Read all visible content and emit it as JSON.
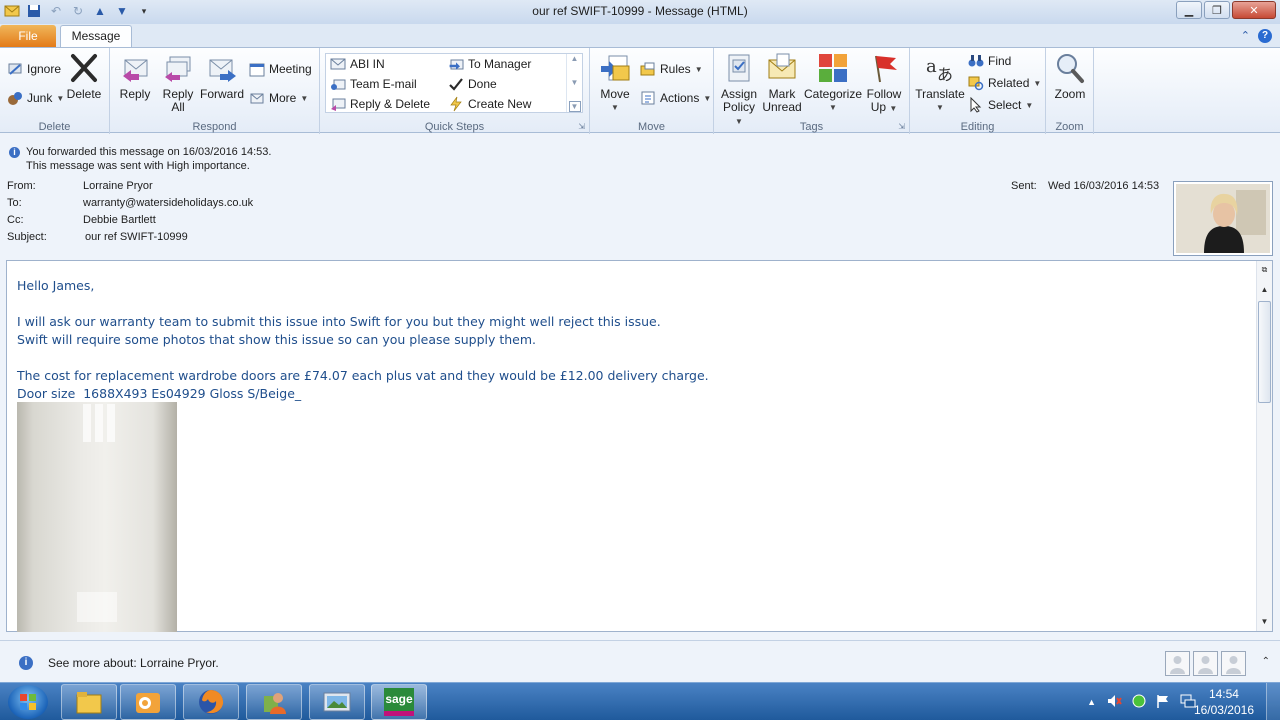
{
  "window": {
    "title": "our ref SWIFT-10999  -  Message (HTML)"
  },
  "tabs": {
    "file": "File",
    "message": "Message"
  },
  "ribbon": {
    "delete": {
      "label": "Delete",
      "ignore": "Ignore",
      "junk": "Junk",
      "delete": "Delete"
    },
    "respond": {
      "label": "Respond",
      "reply": "Reply",
      "reply_all_1": "Reply",
      "reply_all_2": "All",
      "forward": "Forward",
      "meeting": "Meeting",
      "more": "More"
    },
    "quick_steps": {
      "label": "Quick Steps",
      "items": [
        "ABI IN",
        "Team E-mail",
        "Reply & Delete",
        "To Manager",
        "Done",
        "Create New"
      ]
    },
    "move": {
      "label": "Move",
      "move": "Move",
      "rules": "Rules",
      "actions": "Actions"
    },
    "tags": {
      "label": "Tags",
      "assign_1": "Assign",
      "assign_2": "Policy",
      "mark_1": "Mark",
      "mark_2": "Unread",
      "categorize": "Categorize",
      "follow_1": "Follow",
      "follow_2": "Up"
    },
    "editing": {
      "label": "Editing",
      "translate": "Translate",
      "find": "Find",
      "related": "Related",
      "select": "Select"
    },
    "zoom": {
      "label": "Zoom",
      "zoom": "Zoom"
    }
  },
  "info": {
    "line1": "You forwarded this message on 16/03/2016 14:53.",
    "line2": "This message was sent with High importance."
  },
  "header": {
    "from_label": "From:",
    "from": "Lorraine Pryor",
    "to_label": "To:",
    "to": "warranty@watersideholidays.co.uk",
    "cc_label": "Cc:",
    "cc": "Debbie Bartlett",
    "subject_label": "Subject:",
    "subject": "our ref SWIFT-10999",
    "sent_label": "Sent:",
    "sent": "Wed 16/03/2016 14:53"
  },
  "body": {
    "lines": [
      "Hello James,",
      "",
      "I will ask our warranty team to submit this issue into Swift for you but they might well reject this issue.",
      "Swift will require some photos that show this issue so can you please supply them.",
      "",
      "The cost for replacement wardrobe doors are £74.07 each plus vat and they would be £12.00 delivery charge.",
      "Door size  1688X493 Es04929 Gloss S/Beige_"
    ]
  },
  "people_pane": {
    "text": "See more about: Lorraine Pryor."
  },
  "taskbar": {
    "time": "14:54",
    "date": "16/03/2016",
    "sage": "sage"
  }
}
